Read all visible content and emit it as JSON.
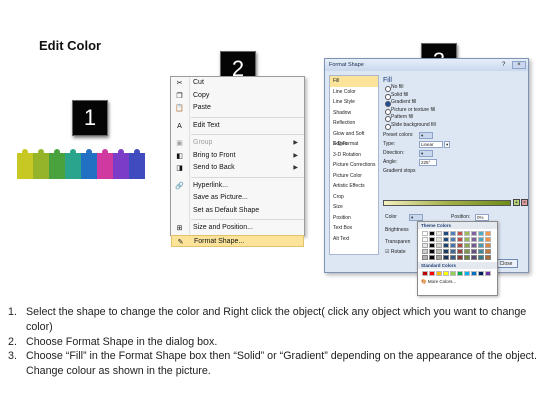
{
  "title": "Edit Color",
  "steps": [
    "1",
    "2",
    "3"
  ],
  "strip_colors": [
    "#c8c825",
    "#96b42a",
    "#4aa23e",
    "#2aa48c",
    "#2270c4",
    "#d03aa0",
    "#7b3cc8",
    "#3f4bbf"
  ],
  "context_menu": {
    "items": [
      {
        "label": "Cut",
        "icon": "scissors-icon",
        "glyph": "✂"
      },
      {
        "label": "Copy",
        "icon": "copy-icon",
        "glyph": "❐"
      },
      {
        "label": "Paste",
        "icon": "paste-icon",
        "glyph": "📋"
      },
      {
        "label": "Edit Text",
        "icon": "edit-text-icon",
        "glyph": "A"
      },
      {
        "label": "Group",
        "icon": "group-icon",
        "glyph": "▣"
      },
      {
        "label": "Bring to Front",
        "icon": "bring-front-icon",
        "glyph": "◧"
      },
      {
        "label": "Send to Back",
        "icon": "send-back-icon",
        "glyph": "◨"
      },
      {
        "label": "Hyperlink...",
        "icon": "hyperlink-icon",
        "glyph": "🔗"
      },
      {
        "label": "Save as Picture...",
        "icon": "",
        "glyph": ""
      },
      {
        "label": "Set as Default Shape",
        "icon": "",
        "glyph": ""
      },
      {
        "label": "Size and Position...",
        "icon": "size-position-icon",
        "glyph": "⊞"
      },
      {
        "label": "Format Shape...",
        "icon": "format-shape-icon",
        "glyph": "✎"
      }
    ]
  },
  "dialog": {
    "title": "Format Shape",
    "close_label": "Close",
    "categories": [
      "Fill",
      "Line Color",
      "Line Style",
      "Shadow",
      "Reflection",
      "Glow and Soft Edges",
      "3-D Format",
      "3-D Rotation",
      "Picture Corrections",
      "Picture Color",
      "Artistic Effects",
      "Crop",
      "Size",
      "Position",
      "Text Box",
      "Alt Text"
    ],
    "fill_heading": "Fill",
    "fill_options": [
      "No fill",
      "Solid fill",
      "Gradient fill",
      "Picture or texture fill",
      "Pattern fill",
      "Slide background fill"
    ],
    "preset_label": "Preset colors:",
    "type_label": "Type:",
    "type_value": "Linear",
    "direction_label": "Direction:",
    "angle_label": "Angle:",
    "angle_value": "225°",
    "stops_label": "Gradient stops",
    "color_label": "Color",
    "position_label": "Position:",
    "position_value": "0%",
    "brightness_label": "Brightness",
    "transparency_label": "Transparen",
    "rotate_label": "Rotate"
  },
  "color_popup": {
    "theme_label": "Theme Colors",
    "standard_label": "Standard Colors",
    "more_label": "More Colors...",
    "theme_top": [
      "#ffffff",
      "#000000",
      "#eeece1",
      "#1f497d",
      "#4f81bd",
      "#c0504d",
      "#9bbb59",
      "#8064a2",
      "#4bacc6",
      "#f79646"
    ],
    "standard": [
      "#c00000",
      "#ff0000",
      "#ffc000",
      "#ffff00",
      "#92d050",
      "#00b050",
      "#00b0f0",
      "#0070c0",
      "#002060",
      "#7030a0"
    ]
  },
  "instructions": [
    {
      "num": "1.",
      "text": "Select the shape to change the color and Right click the object( click any object which you want to change color)"
    },
    {
      "num": "2.",
      "text": "Choose Format Shape in the dialog box."
    },
    {
      "num": "3.",
      "text": "Choose “Fill” in the Format Shape box then “Solid” or “Gradient” depending on the appearance of the object. Change colour as shown in the picture."
    }
  ]
}
